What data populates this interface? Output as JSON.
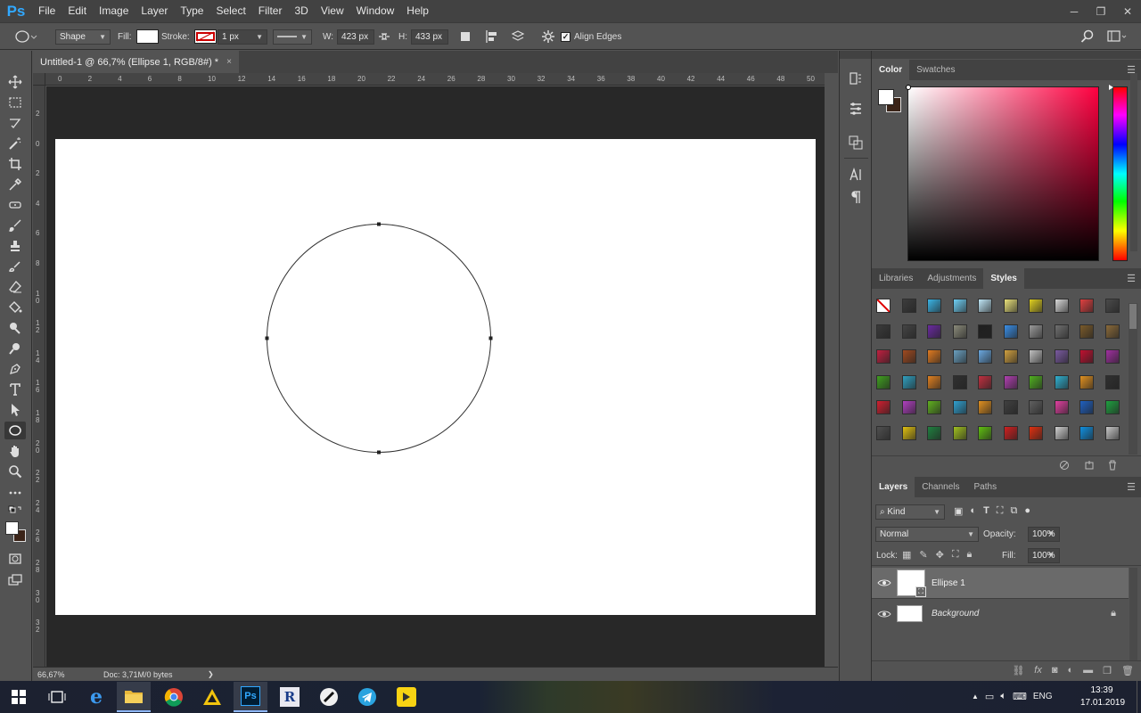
{
  "app": {
    "logo": "Ps"
  },
  "menu": [
    "File",
    "Edit",
    "Image",
    "Layer",
    "Type",
    "Select",
    "Filter",
    "3D",
    "View",
    "Window",
    "Help"
  ],
  "window_controls": {
    "minimize": "─",
    "restore": "❐",
    "close": "✕"
  },
  "options": {
    "mode": "Shape",
    "fill_label": "Fill:",
    "stroke_label": "Stroke:",
    "stroke_width": "1 px",
    "w_label": "W:",
    "w_value": "423 px",
    "h_label": "H:",
    "h_value": "433 px",
    "align_edges": "Align Edges"
  },
  "document": {
    "tab_title": "Untitled-1 @ 66,7% (Ellipse 1, RGB/8#) *",
    "close": "×"
  },
  "ruler": {
    "top": [
      "0",
      "2",
      "4",
      "6",
      "8",
      "10",
      "12",
      "14",
      "16",
      "18",
      "20",
      "22",
      "24",
      "26",
      "28",
      "30",
      "32",
      "34",
      "36",
      "38",
      "40",
      "42",
      "44",
      "46",
      "48",
      "50"
    ],
    "left": [
      "2",
      "0",
      "2",
      "4",
      "6",
      "8",
      "1 0",
      "1 2",
      "1 4",
      "1 6",
      "1 8",
      "2 0",
      "2 2",
      "2 4",
      "2 6",
      "2 8",
      "3 0",
      "3 2"
    ]
  },
  "status": {
    "zoom": "66,67%",
    "doc": "Doc: 3,71M/0 bytes",
    "arrow": "❯"
  },
  "color_panel": {
    "tabs": [
      "Color",
      "Swatches"
    ],
    "active": "Color"
  },
  "styles_panel": {
    "tabs": [
      "Libraries",
      "Adjustments",
      "Styles"
    ],
    "active": "Styles"
  },
  "styles": [
    [
      "#ffffff",
      "#3c3c3c",
      "#3ab4e6",
      "#6fd0f5",
      "#bfe6f6",
      "#e8e07a",
      "#e0d020",
      "#d8d8d8",
      "#e04040",
      "#4a4a4a"
    ],
    [
      "#3a3a3a",
      "#444444",
      "#6a2aa0",
      "#8a8a7a",
      "#202020",
      "#3a8ee6",
      "#9a9a9a",
      "#707070",
      "#7a5a2a",
      "#8a6a3a"
    ],
    [
      "#c02040",
      "#a04a20",
      "#e07a20",
      "#6aa0c0",
      "#6aa8e0",
      "#d0a040",
      "#c0c0c0",
      "#7a5aa0",
      "#c01030",
      "#a030a0"
    ],
    [
      "#40a020",
      "#30a0c0",
      "#e08020",
      "#303030",
      "#c03040",
      "#b040b0",
      "#50b020",
      "#30b0d0",
      "#e09020",
      "#303030"
    ],
    [
      "#d02030",
      "#b040c0",
      "#60b020",
      "#30a0d0",
      "#e09020",
      "#404040",
      "#606060",
      "#e040a0",
      "#2060c0",
      "#20a040"
    ],
    [
      "#505050",
      "#e0c010",
      "#208040",
      "#a0c020",
      "#60c010",
      "#d02020",
      "#e03010",
      "#d0d0d0",
      "#1090e0",
      "#c8c8c8"
    ]
  ],
  "layers_panel": {
    "tabs": [
      "Layers",
      "Channels",
      "Paths"
    ],
    "active": "Layers",
    "kind": "Kind",
    "blend": "Normal",
    "opacity_label": "Opacity:",
    "opacity": "100%",
    "lock_label": "Lock:",
    "fill_label": "Fill:",
    "fill": "100%",
    "layers": [
      {
        "name": "Ellipse 1",
        "selected": true
      },
      {
        "name": "Background",
        "selected": false
      }
    ]
  },
  "taskbar": {
    "lang": "ENG",
    "time": "13:39",
    "date": "17.01.2019"
  },
  "colors": {
    "panel_bg": "#535353",
    "menubar": "#424242",
    "workarea": "#282828",
    "accent": "#31a8ff"
  }
}
